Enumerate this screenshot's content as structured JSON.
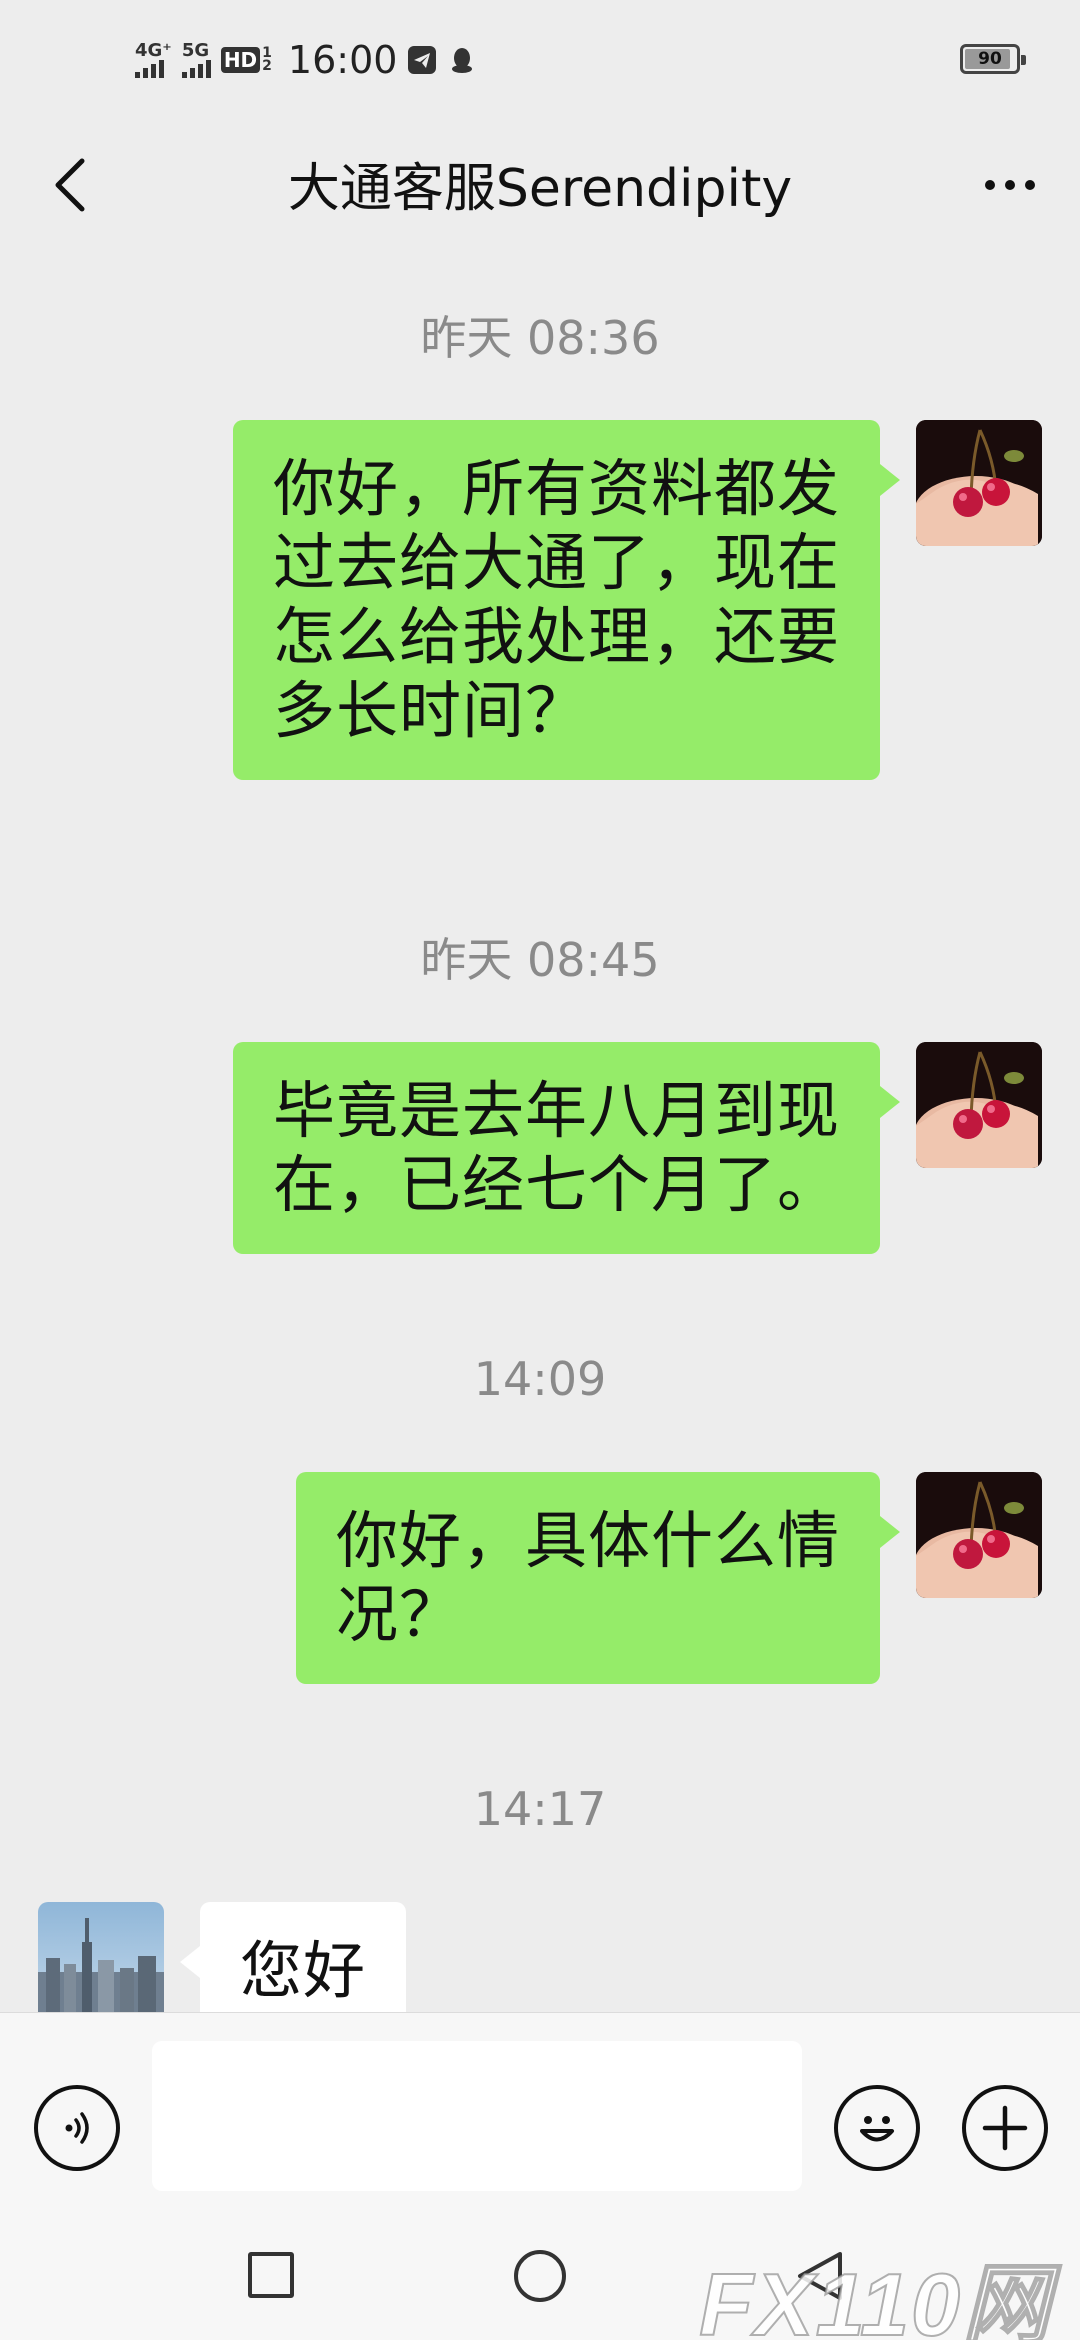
{
  "status_bar": {
    "network_1": "4G⁺",
    "network_2": "5G",
    "hd_badge": "HD",
    "hd_sub_top": "1",
    "hd_sub_bottom": "2",
    "time": "16:00",
    "battery_level": 0.9,
    "battery_text": "90"
  },
  "nav": {
    "title": "大通客服Serendipity"
  },
  "messages": [
    {
      "timestamp": "昨天 08:36",
      "side": "right",
      "text_lines": [
        "你好，所有资料都发",
        "过去给大通了，现在",
        "怎么给我处理，还要",
        "多长时间？"
      ]
    },
    {
      "timestamp": "昨天 08:45",
      "side": "right",
      "text_lines": [
        "毕竟是去年八月到现",
        "在，已经七个月了。"
      ]
    },
    {
      "timestamp": "14:09",
      "side": "right",
      "text_lines": [
        "你好，具体什么情",
        "况？"
      ]
    },
    {
      "timestamp": "14:17",
      "side": "left",
      "text_lines": [
        "您好"
      ]
    }
  ],
  "input": {
    "value": ""
  },
  "watermark": "FX110网",
  "colors": {
    "chat_bg": "#ededed",
    "sent_bubble": "#95ec69",
    "received_bubble": "#ffffff",
    "timestamp": "#8a8a8a"
  },
  "icons": {
    "back": "chevron-left-icon",
    "more": "more-dots-icon",
    "voice": "voice-icon",
    "emoji": "emoji-icon",
    "plus": "plus-icon"
  }
}
